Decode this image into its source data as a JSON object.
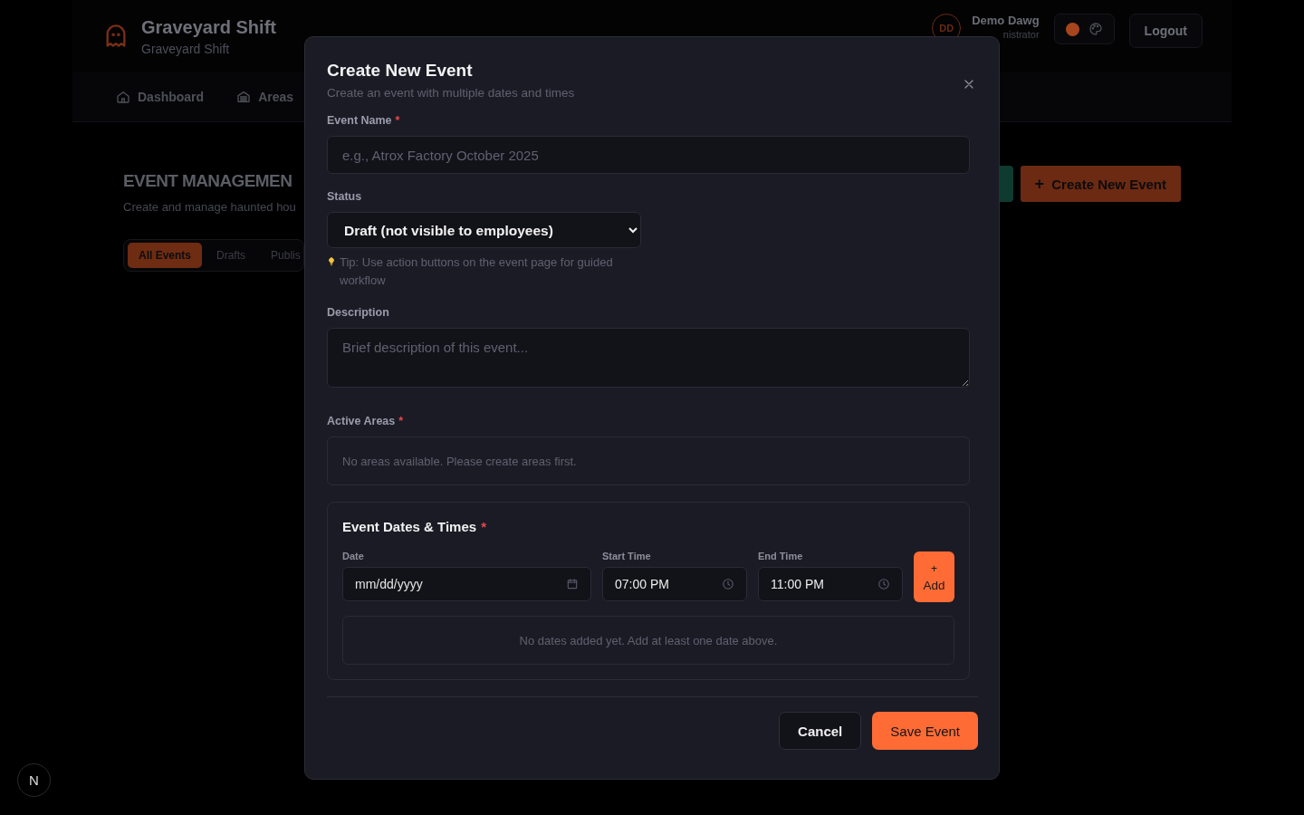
{
  "app": {
    "title": "Graveyard Shift",
    "subtitle": "Graveyard Shift"
  },
  "user": {
    "initials": "DD",
    "name": "Demo Dawg",
    "role": "nistrator"
  },
  "theme_toggle": {
    "color": "#a8451c"
  },
  "logout": "Logout",
  "nav": [
    {
      "label": "Dashboard",
      "kind": "home"
    },
    {
      "label": "Areas",
      "kind": "building"
    }
  ],
  "page": {
    "heading": "EVENT MANAGEMEN",
    "subheading": "Create and manage haunted hou",
    "create_button": {
      "icon": "+",
      "label": "Create New Event"
    },
    "filters": [
      {
        "label": "All Events",
        "selected": true
      },
      {
        "label": "Drafts",
        "selected": false
      },
      {
        "label": "Publis",
        "selected": false
      }
    ]
  },
  "modal": {
    "title": "Create New Event",
    "subtitle": "Create an event with multiple dates and times",
    "event_name": {
      "label": "Event Name",
      "required_mark": "*",
      "placeholder": "e.g., Atrox Factory October 2025"
    },
    "status": {
      "label": "Status",
      "value": "Draft (not visible to employees)",
      "tip": "Tip: Use action buttons on the event page for guided workflow"
    },
    "description": {
      "label": "Description",
      "placeholder": "Brief description of this event..."
    },
    "active_areas": {
      "label": "Active Areas",
      "required_mark": "*",
      "empty_text": "No areas available. Please create areas first."
    },
    "dates": {
      "title": "Event Dates & Times",
      "required_mark": "*",
      "date": {
        "label": "Date",
        "placeholder": "mm/dd/yyyy"
      },
      "start": {
        "label": "Start Time",
        "value": "07:00 PM"
      },
      "end": {
        "label": "End Time",
        "value": "11:00 PM"
      },
      "add_button": {
        "icon": "+",
        "label": "Add"
      },
      "empty_text": "No dates added yet. Add at least one date above."
    },
    "cancel": "Cancel",
    "save": "Save Event"
  },
  "dev_badge": "N"
}
